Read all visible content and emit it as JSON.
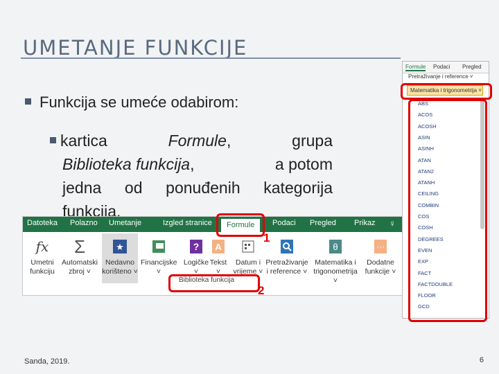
{
  "slide": {
    "title": "UMETANJE FUNKCIJE",
    "bullet1": "Funkcija se umeće odabirom:",
    "bullet2": {
      "w_kartica": "kartica",
      "w_formule": "Formule",
      "w_comma1": ",",
      "w_grupa": "grupa",
      "w_biblioteka": "Biblioteka funkcija",
      "w_comma2": ",",
      "w_apotom": "a potom",
      "line3": "jedna od ponuđenih kategorija",
      "line4": "funkcija."
    },
    "footer": "Sanda, 2019.",
    "page_number": "6"
  },
  "ribbon": {
    "tabs": [
      "Datoteka",
      "Polazno",
      "Umetanje",
      "Izgled stranice",
      "Formule",
      "Podaci",
      "Pregled",
      "Prikaz"
    ],
    "active_tab": "Formule",
    "buttons": [
      {
        "line1": "Umetni",
        "line2": "funkciju"
      },
      {
        "line1": "Automatski",
        "line2": "zbroj ˅"
      },
      {
        "line1": "Nedavno",
        "line2": "korišteno ˅"
      },
      {
        "line1": "Financijske",
        "line2": "˅"
      },
      {
        "line1": "Logičke",
        "line2": "˅"
      },
      {
        "line1": "Tekst",
        "line2": "˅"
      },
      {
        "line1": "Datum i",
        "line2": "vrijeme ˅"
      },
      {
        "line1": "Pretraživanje",
        "line2": "i reference ˅"
      },
      {
        "line1": "Matematika i",
        "line2": "trigonometrija ˅"
      },
      {
        "line1": "Dodatne",
        "line2": "funkcije ˅"
      }
    ],
    "group_label": "Biblioteka funkcija",
    "callout1": "1",
    "callout2": "2"
  },
  "panel": {
    "tabs": [
      "Formule",
      "Podaci",
      "Pregled"
    ],
    "menu_item": "Pretraživanje i reference ˅",
    "selected_category": "Matematika i trigonometrija ˅",
    "functions": [
      "ABS",
      "ACOS",
      "ACOSH",
      "ASIN",
      "ASINH",
      "ATAN",
      "ATAN2",
      "ATANH",
      "CEILING",
      "COMBIN",
      "COS",
      "COSH",
      "DEGREES",
      "EVEN",
      "EXP",
      "FACT",
      "FACTDOUBLE",
      "FLOOR",
      "GCD"
    ]
  },
  "colors": {
    "excel_green": "#217346",
    "highlight_red": "#e00000",
    "title_color": "#5a6a7f"
  }
}
